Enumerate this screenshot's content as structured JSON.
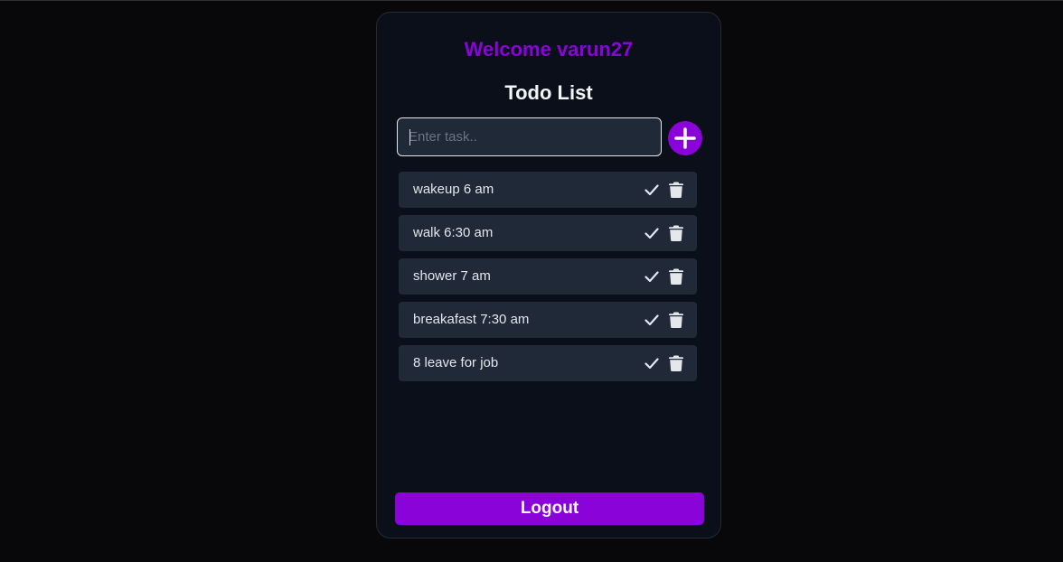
{
  "header": {
    "welcome": "Welcome varun27",
    "title": "Todo List"
  },
  "input": {
    "placeholder": "Enter task..",
    "value": ""
  },
  "add_button": {
    "icon": "plus-icon"
  },
  "todos": [
    {
      "text": "wakeup 6 am"
    },
    {
      "text": "walk 6:30 am"
    },
    {
      "text": "shower 7 am"
    },
    {
      "text": "breakafast 7:30 am"
    },
    {
      "text": "8 leave for job"
    }
  ],
  "actions": {
    "complete_icon": "check-icon",
    "delete_icon": "trash-icon"
  },
  "footer": {
    "logout_label": "Logout"
  },
  "colors": {
    "background": "#08080a",
    "card": "#0b0f19",
    "accent": "#8a03d9",
    "item": "#1f2937",
    "text": "#e5e7eb"
  }
}
